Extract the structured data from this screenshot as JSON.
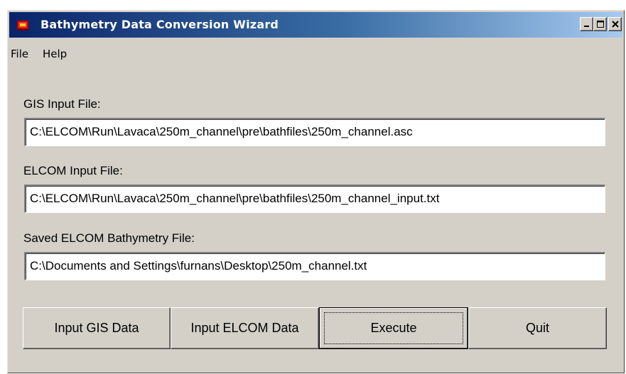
{
  "window": {
    "title": "Bathymetry Data Conversion Wizard"
  },
  "menu": {
    "items": [
      {
        "label": "File"
      },
      {
        "label": "Help"
      }
    ]
  },
  "fields": {
    "gis": {
      "label": "GIS Input File:",
      "value": "C:\\ELCOM\\Run\\Lavaca\\250m_channel\\pre\\bathfiles\\250m_channel.asc"
    },
    "elcom": {
      "label": "ELCOM Input File:",
      "value": "C:\\ELCOM\\Run\\Lavaca\\250m_channel\\pre\\bathfiles\\250m_channel_input.txt"
    },
    "saved": {
      "label": "Saved ELCOM Bathymetry File:",
      "value": "C:\\Documents and Settings\\furnans\\Desktop\\250m_channel.txt"
    }
  },
  "buttons": {
    "input_gis": "Input GIS Data",
    "input_elcom": "Input ELCOM Data",
    "execute": "Execute",
    "quit": "Quit"
  }
}
